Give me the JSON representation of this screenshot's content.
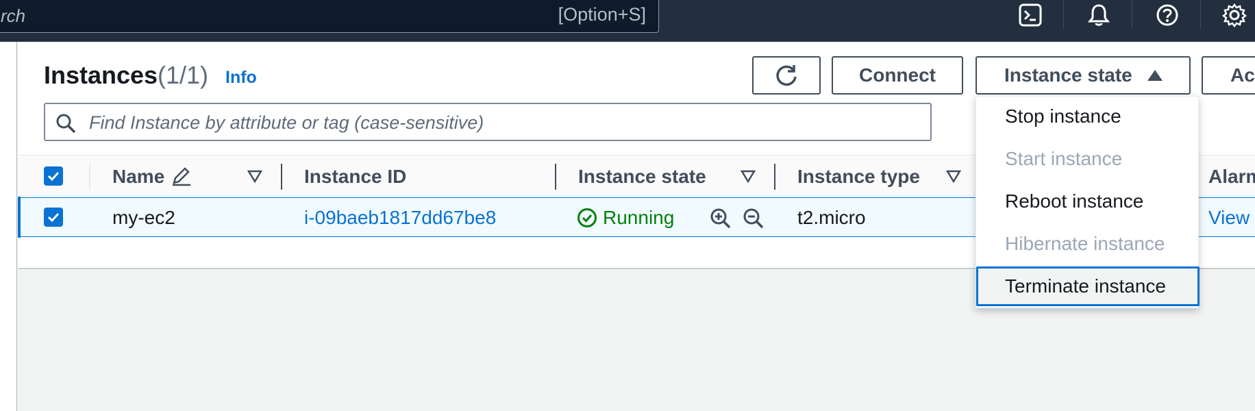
{
  "topnav": {
    "search_placeholder": "rch",
    "search_shortcut": "[Option+S]",
    "icons": [
      "cloudshell-icon",
      "bell-icon",
      "help-icon",
      "gear-icon"
    ]
  },
  "panel": {
    "title": "Instances",
    "count": "(1/1)",
    "info": "Info",
    "connect_label": "Connect",
    "instance_state_label": "Instance state",
    "actions_label": "Ac",
    "filter_placeholder": "Find Instance by attribute or tag (case-sensitive)"
  },
  "table": {
    "headers": {
      "name": "Name",
      "instance_id": "Instance ID",
      "instance_state": "Instance state",
      "instance_type": "Instance type",
      "alarm": "Alarm"
    },
    "rows": [
      {
        "name": "my-ec2",
        "instance_id": "i-09baeb1817dd67be8",
        "state": "Running",
        "type": "t2.micro",
        "alarm": "View"
      }
    ]
  },
  "dropdown": {
    "items": [
      {
        "label": "Stop instance",
        "disabled": false
      },
      {
        "label": "Start instance",
        "disabled": true
      },
      {
        "label": "Reboot instance",
        "disabled": false
      },
      {
        "label": "Hibernate instance",
        "disabled": true
      },
      {
        "label": "Terminate instance",
        "disabled": false,
        "focused": true
      }
    ]
  },
  "colors": {
    "nav_bg": "#232f3e",
    "link": "#0972d3",
    "running": "#037f0c",
    "disabled": "#9ba7b6"
  }
}
